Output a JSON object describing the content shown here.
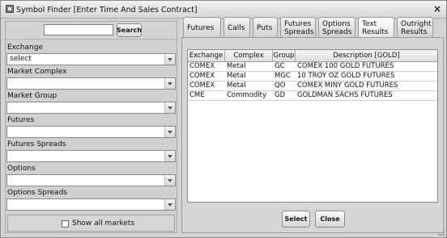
{
  "window": {
    "title": "Symbol Finder [Enter Time And Sales Contract]",
    "close_glyph": "×"
  },
  "search": {
    "value": "",
    "placeholder": "",
    "button_label": "Search"
  },
  "filters": {
    "exchange_label": "Exchange",
    "exchange_value": "select",
    "market_complex_label": "Market Complex",
    "market_complex_value": "",
    "market_group_label": "Market Group",
    "market_group_value": "",
    "futures_label": "Futures",
    "futures_value": "",
    "futures_spreads_label": "Futures Spreads",
    "futures_spreads_value": "",
    "options_label": "Options",
    "options_value": "",
    "options_spreads_label": "Options Spreads",
    "options_spreads_value": ""
  },
  "show_all": {
    "label": "Show all markets",
    "checked": false
  },
  "tabs": [
    {
      "line1": "Futures",
      "line2": ""
    },
    {
      "line1": "Calls",
      "line2": ""
    },
    {
      "line1": "Puts",
      "line2": ""
    },
    {
      "line1": "Futures",
      "line2": "Spreads"
    },
    {
      "line1": "Options",
      "line2": "Spreads"
    },
    {
      "line1": "Text",
      "line2": "Results"
    },
    {
      "line1": "Outright",
      "line2": "Results"
    }
  ],
  "active_tab": "Text Results",
  "results": {
    "columns": [
      "Exchange",
      "Complex",
      "Group",
      "Description [GOLD]"
    ],
    "rows": [
      [
        "COMEX",
        "Metal",
        "GC",
        "COMEX 100 GOLD FUTURES"
      ],
      [
        "COMEX",
        "Metal",
        "MGC",
        "10 TROY OZ GOLD FUTURES"
      ],
      [
        "COMEX",
        "Metal",
        "QO",
        "COMEX MINY GOLD FUTURES"
      ],
      [
        "CME",
        "Commodity",
        "GD",
        "GOLDMAN SACHS FUTURES"
      ]
    ]
  },
  "actions": {
    "select_label": "Select",
    "close_label": "Close"
  }
}
